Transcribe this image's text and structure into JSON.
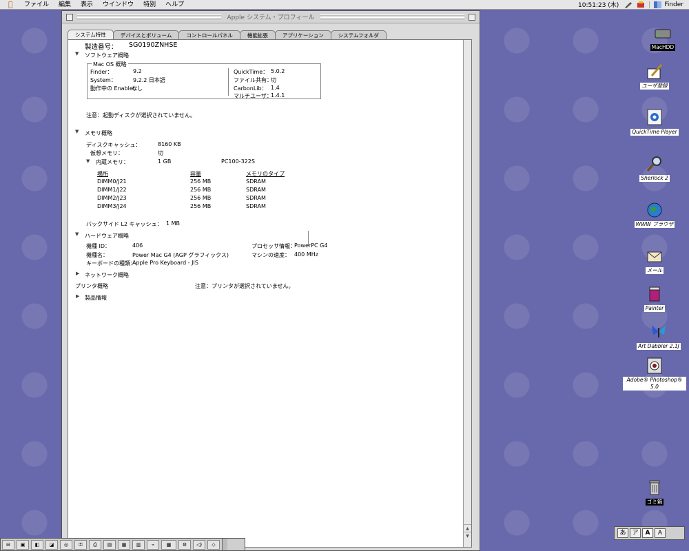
{
  "menubar": {
    "items": [
      "ファイル",
      "編集",
      "表示",
      "ウインドウ",
      "特別",
      "ヘルプ"
    ],
    "clock": "10:51:23 (木)",
    "app": "Finder"
  },
  "window": {
    "title": "Apple システム・プロフィール",
    "tabs": [
      "システム特性",
      "デバイスとボリューム",
      "コントロールパネル",
      "機能拡張",
      "アプリケーション",
      "システムフォルダ"
    ],
    "active_tab": 0
  },
  "profile": {
    "serial_label": "製造番号：",
    "serial_value": "SG0190ZNHSE",
    "software": {
      "heading": "ソフトウェア概略",
      "box_title": "Mac OS 概略",
      "finder_label": "Finder：",
      "finder_value": "9.2",
      "system_label": "System：",
      "system_value": "9.2.2 日本語",
      "enabler_label": "動作中の Enabler：",
      "enabler_value": "なし",
      "quicktime_label": "QuickTime：",
      "quicktime_value": "5.0.2",
      "filesharing_label": "ファイル共有：",
      "filesharing_value": "切",
      "carbonlib_label": "CarbonLib：",
      "carbonlib_value": "1.4",
      "multiuser_label": "マルチユーザ：",
      "multiuser_value": "1.4.1"
    },
    "removable_note": "注意：起動ディスクが選択されていません。",
    "memory": {
      "heading": "メモリ概略",
      "disk_cache_label": "ディスクキャッシュ：",
      "disk_cache_value": "8160 KB",
      "virtual_label": "仮想メモリ：",
      "virtual_value": "切",
      "builtin_label": "内蔵メモリ：",
      "builtin_value": "1 GB",
      "builtin_type": "PC100-322S",
      "table_headers": [
        "場所",
        "容量",
        "メモリのタイプ"
      ],
      "rows": [
        [
          "DIMM0/J21",
          "256 MB",
          "SDRAM"
        ],
        [
          "DIMM1/J22",
          "256 MB",
          "SDRAM"
        ],
        [
          "DIMM2/J23",
          "256 MB",
          "SDRAM"
        ],
        [
          "DIMM3/J24",
          "256 MB",
          "SDRAM"
        ]
      ],
      "l2_label": "バックサイド L2 キャッシュ：",
      "l2_value": "1 MB"
    },
    "hardware": {
      "heading": "ハードウェア概略",
      "model_id_label": "機種 ID：",
      "model_id_value": "406",
      "model_name_label": "機種名：",
      "model_name_value": "Power Mac G4 (AGP グラフィックス)",
      "keyboard_label": "キーボードの種類：",
      "keyboard_value": "Apple Pro Keyboard - JIS",
      "processor_label": "プロセッサ情報：",
      "processor_value": "PowerPC G4",
      "speed_label": "マシンの速度：",
      "speed_value": "400 MHz"
    },
    "network_heading": "ネットワーク概略",
    "printer_label": "プリンタ概略",
    "printer_note": "注意：プリンタが選択されていません。",
    "product_heading": "製品情報"
  },
  "desktop": {
    "icons": [
      {
        "label": "MacHDD",
        "icon": "hard-disk-icon"
      },
      {
        "label": "ユーザ登録",
        "icon": "register-icon"
      },
      {
        "label": "QuickTime Player",
        "icon": "quicktime-icon"
      },
      {
        "label": "Sherlock 2",
        "icon": "sherlock-icon"
      },
      {
        "label": "WWW ブラウザ",
        "icon": "browser-icon"
      },
      {
        "label": "メール",
        "icon": "mail-icon"
      },
      {
        "label": "Painter",
        "icon": "painter-icon"
      },
      {
        "label": "Art Dabbler 2.1J",
        "icon": "art-dabbler-icon"
      },
      {
        "label": "Adobe® Photoshop® 5.0",
        "icon": "photoshop-icon"
      },
      {
        "label": "ゴミ箱",
        "icon": "trash-icon"
      }
    ]
  },
  "ime_palette": {
    "keys": [
      "あ",
      "ア",
      "A",
      "A"
    ]
  },
  "colors": {
    "desktop": "#6868ac",
    "window": "#dcdcdc",
    "apple_logo": "#c8541c"
  }
}
